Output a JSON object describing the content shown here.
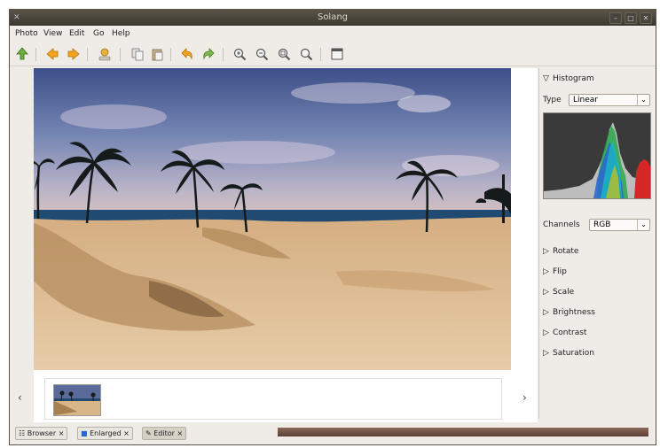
{
  "app": {
    "title": "Solang"
  },
  "menu": [
    "Photo",
    "View",
    "Edit",
    "Go",
    "Help"
  ],
  "toolbar_icons": [
    "import-icon",
    "back-icon",
    "forward-icon",
    "user-icon",
    "copy-icon",
    "paste-icon",
    "undo-icon",
    "redo-icon",
    "zoom-in-icon",
    "zoom-out-icon",
    "zoom-fit-icon",
    "zoom-original-icon",
    "fullscreen-icon"
  ],
  "photo": {
    "subject": "beach dunes with palm trees"
  },
  "sidebar": {
    "histogram_title": "Histogram",
    "type_label": "Type",
    "type_value": "Linear",
    "channels_label": "Channels",
    "channels_value": "RGB",
    "sections": [
      "Rotate",
      "Flip",
      "Scale",
      "Brightness",
      "Contrast",
      "Saturation"
    ]
  },
  "status": {
    "browser": "Browser",
    "enlarged": "Enlarged",
    "editor": "Editor"
  },
  "colors": {
    "titlebar": "#4a453c",
    "window_bg": "#efebe7",
    "sky_top": "#3a4f8a",
    "sand": "#d9b88c",
    "sea": "#1f4a73"
  }
}
